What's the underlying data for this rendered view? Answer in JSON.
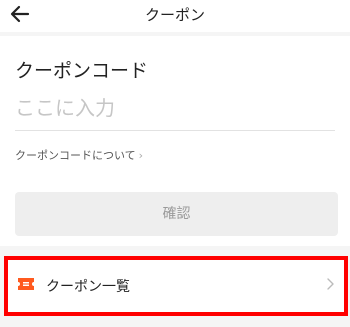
{
  "header": {
    "title": "クーポン",
    "back_icon": "back-arrow-icon"
  },
  "coupon_form": {
    "heading": "クーポンコード",
    "input_value": "",
    "input_placeholder": "ここに入力",
    "about_link": "クーポンコードについて",
    "confirm_label": "確認"
  },
  "coupon_list": {
    "label": "クーポン一覧",
    "icon": "ticket-icon",
    "icon_color": "#ff5a1f"
  },
  "colors": {
    "highlight_border": "#ff0000"
  }
}
